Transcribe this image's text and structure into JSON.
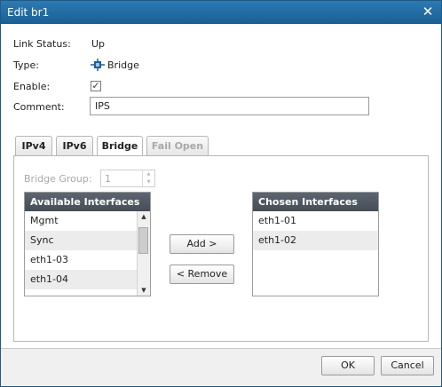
{
  "dialog": {
    "title": "Edit br1",
    "close_icon": "close-icon"
  },
  "fields": {
    "link_status_label": "Link Status:",
    "link_status_value": "Up",
    "type_label": "Type:",
    "type_value": "Bridge",
    "type_icon": "bridge-icon",
    "enable_label": "Enable:",
    "enable_checked": true,
    "enable_mark": "✓",
    "comment_label": "Comment:",
    "comment_value": "IPS"
  },
  "tabs": [
    {
      "label": "IPv4",
      "active": false,
      "disabled": false
    },
    {
      "label": "IPv6",
      "active": false,
      "disabled": false
    },
    {
      "label": "Bridge",
      "active": true,
      "disabled": false
    },
    {
      "label": "Fail Open",
      "active": false,
      "disabled": true
    }
  ],
  "bridge_group": {
    "label": "Bridge Group:",
    "value": "1"
  },
  "available": {
    "header": "Available Interfaces",
    "items": [
      "Mgmt",
      "Sync",
      "eth1-03",
      "eth1-04"
    ]
  },
  "chosen": {
    "header": "Chosen Interfaces",
    "items": [
      "eth1-01",
      "eth1-02"
    ]
  },
  "actions": {
    "add_label": "Add >",
    "remove_label": "< Remove"
  },
  "footer": {
    "ok_label": "OK",
    "cancel_label": "Cancel"
  },
  "colors": {
    "titlebar": "#1f5f95",
    "list_header": "#4f5861"
  }
}
